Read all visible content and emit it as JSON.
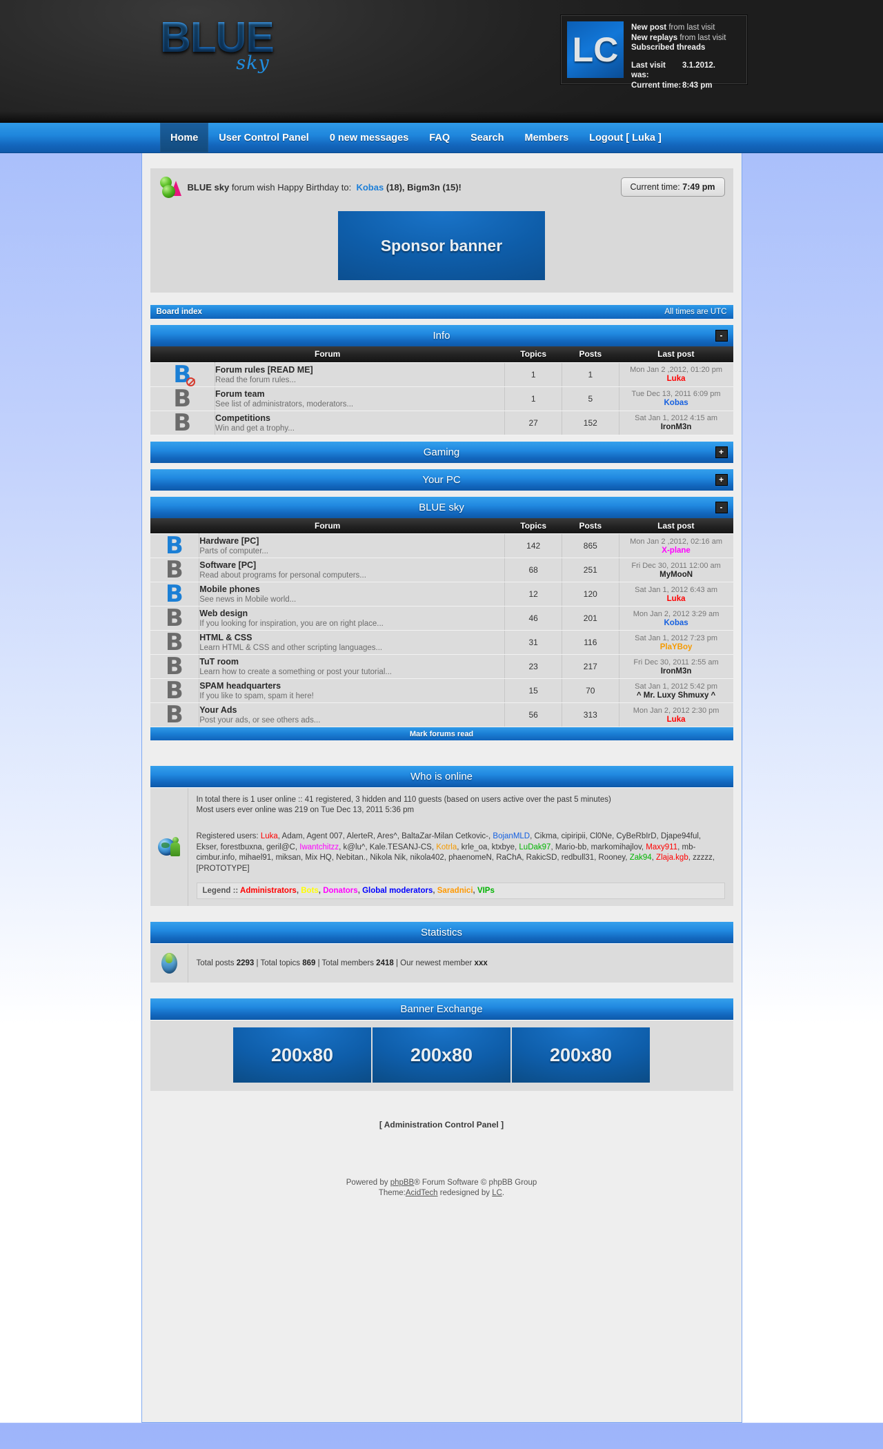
{
  "header": {
    "logo_main": "BLUE",
    "logo_sub": "sky",
    "infobox": {
      "avatar_text": "LC",
      "line1_strong": "New post",
      "line1_rest": " from last visit",
      "line2_strong": "New replays",
      "line2_rest": " from last visit",
      "line3": "Subscribed threads",
      "last_visit_label": "Last visit was:",
      "last_visit_value": "3.1.2012.",
      "current_time_label": "Current time:",
      "current_time_value": "8:43 pm"
    }
  },
  "nav": {
    "items": [
      {
        "label": "Home",
        "active": true
      },
      {
        "label": "User Control Panel",
        "active": false
      },
      {
        "label": "0 new messages",
        "active": false
      },
      {
        "label": "FAQ",
        "active": false
      },
      {
        "label": "Search",
        "active": false
      },
      {
        "label": "Members",
        "active": false
      },
      {
        "label": "Logout [ Luka ]",
        "active": false
      }
    ]
  },
  "announce": {
    "prefix_bold": "BLUE sky",
    "prefix_rest": " forum wish Happy Birthday to:",
    "birthday_link": "Kobas",
    "birthday_rest": " (18), Bigm3n (15)!",
    "current_time_button_label": "Current time:",
    "current_time_button_value": "7:49 pm",
    "sponsor_banner": "Sponsor banner"
  },
  "boardbar": {
    "left": "Board index",
    "right": "All times are UTC"
  },
  "table_headers": {
    "forum": "Forum",
    "topics": "Topics",
    "posts": "Posts",
    "last_post": "Last post"
  },
  "categories": [
    {
      "title": "Info",
      "collapsed": false,
      "toggle": "-",
      "forums": [
        {
          "icon": "forum-icon-locked-new",
          "icon_state": "blue",
          "locked": true,
          "title": "Forum rules [READ ME]",
          "desc": "Read the forum rules...",
          "topics": "1",
          "posts": "1",
          "last_date": "Mon Jan 2 ,2012, 01:20 pm",
          "last_user": "Luka",
          "last_user_color": "#ff0000"
        },
        {
          "icon": "forum-icon-read",
          "icon_state": "gray",
          "locked": false,
          "title": "Forum team",
          "desc": "See list of administrators, moderators...",
          "topics": "1",
          "posts": "5",
          "last_date": "Tue Dec 13, 2011 6:09 pm",
          "last_user": "Kobas",
          "last_user_color": "#1560e0"
        },
        {
          "icon": "forum-icon-read",
          "icon_state": "gray",
          "locked": false,
          "title": "Competitions",
          "desc": "Win and get a trophy...",
          "topics": "27",
          "posts": "152",
          "last_date": "Sat Jan 1, 2012 4:15 am",
          "last_user": "IronM3n",
          "last_user_color": "#222222"
        }
      ]
    },
    {
      "title": "Gaming",
      "collapsed": true,
      "toggle": "+",
      "forums": []
    },
    {
      "title": "Your PC",
      "collapsed": true,
      "toggle": "+",
      "forums": []
    },
    {
      "title": "BLUE sky",
      "collapsed": false,
      "toggle": "-",
      "forums": [
        {
          "icon": "forum-icon-new",
          "icon_state": "blue",
          "locked": false,
          "title": "Hardware [PC]",
          "desc": "Parts of computer...",
          "topics": "142",
          "posts": "865",
          "last_date": "Mon Jan 2 ,2012, 02:16 am",
          "last_user": "X-plane",
          "last_user_color": "#ff00ff"
        },
        {
          "icon": "forum-icon-read",
          "icon_state": "gray",
          "locked": false,
          "title": "Software [PC]",
          "desc": "Read about programs for personal computers...",
          "topics": "68",
          "posts": "251",
          "last_date": "Fri Dec 30, 2011 12:00 am",
          "last_user": "MyMooN",
          "last_user_color": "#222222"
        },
        {
          "icon": "forum-icon-new",
          "icon_state": "blue",
          "locked": false,
          "title": "Mobile phones",
          "desc": "See news in Mobile world...",
          "topics": "12",
          "posts": "120",
          "last_date": "Sat Jan 1, 2012 6:43 am",
          "last_user": "Luka",
          "last_user_color": "#ff0000"
        },
        {
          "icon": "forum-icon-read",
          "icon_state": "gray",
          "locked": false,
          "title": "Web design",
          "desc": "If you looking for inspiration, you are on right place...",
          "topics": "46",
          "posts": "201",
          "last_date": "Mon Jan 2, 2012 3:29 am",
          "last_user": "Kobas",
          "last_user_color": "#1560e0"
        },
        {
          "icon": "forum-icon-read",
          "icon_state": "gray",
          "locked": false,
          "title": "HTML & CSS",
          "desc": "Learn HTML & CSS and other scripting languages...",
          "topics": "31",
          "posts": "116",
          "last_date": "Sat Jan 1, 2012 7:23 pm",
          "last_user": "PlaYBoy",
          "last_user_color": "#f59a00"
        },
        {
          "icon": "forum-icon-read",
          "icon_state": "gray",
          "locked": false,
          "title": "TuT room",
          "desc": "Learn how to create a something or post your tutorial...",
          "topics": "23",
          "posts": "217",
          "last_date": "Fri Dec 30, 2011 2:55 am",
          "last_user": "IronM3n",
          "last_user_color": "#222222"
        },
        {
          "icon": "forum-icon-read",
          "icon_state": "gray",
          "locked": false,
          "title": "SPAM headquarters",
          "desc": "If you like to spam, spam it here!",
          "topics": "15",
          "posts": "70",
          "last_date": "Sat Jan 1, 2012 5:42 pm",
          "last_user": "^ Mr. Luxy Shmuxy ^",
          "last_user_color": "#222222"
        },
        {
          "icon": "forum-icon-read",
          "icon_state": "gray",
          "locked": false,
          "title": "Your Ads",
          "desc": "Post your ads, or see others ads...",
          "topics": "56",
          "posts": "313",
          "last_date": "Mon Jan 2, 2012 2:30 pm",
          "last_user": "Luka",
          "last_user_color": "#ff0000"
        }
      ]
    }
  ],
  "mark_forums_read": "Mark forums read",
  "who_is_online": {
    "title": "Who is online",
    "line1": "In total there is 1 user online :: 41 registered, 3 hidden and 110 guests (based on users active over the past 5 minutes)",
    "line2": "Most users ever online was 219 on Tue Dec 13, 2011 5:36 pm",
    "users_prefix": "Registered users:",
    "users": [
      {
        "name": "Luka",
        "color": "#ff0000"
      },
      {
        "name": "Adam",
        "color": "#3a3a3a"
      },
      {
        "name": "Agent 007",
        "color": "#3a3a3a"
      },
      {
        "name": "AlerteR",
        "color": "#3a3a3a"
      },
      {
        "name": "Ares^",
        "color": "#3a3a3a"
      },
      {
        "name": "BaltaZar-Milan Cetkovic-",
        "color": "#3a3a3a"
      },
      {
        "name": "BojanMLD",
        "color": "#1560e0"
      },
      {
        "name": "Cikma",
        "color": "#3a3a3a"
      },
      {
        "name": "cipiripii",
        "color": "#3a3a3a"
      },
      {
        "name": "Cl0Ne",
        "color": "#3a3a3a"
      },
      {
        "name": "CyBeRbIrD",
        "color": "#3a3a3a"
      },
      {
        "name": "Djape94ful",
        "color": "#3a3a3a"
      },
      {
        "name": "Ekser",
        "color": "#3a3a3a"
      },
      {
        "name": "forestbuxna",
        "color": "#3a3a3a"
      },
      {
        "name": "geril@C",
        "color": "#3a3a3a"
      },
      {
        "name": "Iwantchitzz",
        "color": "#ff00ff"
      },
      {
        "name": "k@lu^",
        "color": "#3a3a3a"
      },
      {
        "name": "Kale.TESANJ-CS",
        "color": "#3a3a3a"
      },
      {
        "name": "Kotrla",
        "color": "#f59a00"
      },
      {
        "name": "krle_oa",
        "color": "#3a3a3a"
      },
      {
        "name": "ktxbye",
        "color": "#3a3a3a"
      },
      {
        "name": "LuDak97",
        "color": "#00b400"
      },
      {
        "name": "Mario-bb",
        "color": "#3a3a3a"
      },
      {
        "name": "markomihajlov",
        "color": "#3a3a3a"
      },
      {
        "name": "Maxy911",
        "color": "#ff0000"
      },
      {
        "name": "mb-cimbur.info",
        "color": "#3a3a3a"
      },
      {
        "name": "mihael91",
        "color": "#3a3a3a"
      },
      {
        "name": "miksan",
        "color": "#3a3a3a"
      },
      {
        "name": "Mix HQ",
        "color": "#3a3a3a"
      },
      {
        "name": "Nebitan.",
        "color": "#3a3a3a"
      },
      {
        "name": "Nikola Nik",
        "color": "#3a3a3a"
      },
      {
        "name": "nikola402",
        "color": "#3a3a3a"
      },
      {
        "name": "phaenomeN",
        "color": "#3a3a3a"
      },
      {
        "name": "RaChA",
        "color": "#3a3a3a"
      },
      {
        "name": "RakicSD",
        "color": "#3a3a3a"
      },
      {
        "name": "redbull31",
        "color": "#3a3a3a"
      },
      {
        "name": "Rooney",
        "color": "#3a3a3a"
      },
      {
        "name": "Zak94",
        "color": "#00b400"
      },
      {
        "name": "Zlaja.kgb",
        "color": "#ff0000"
      },
      {
        "name": "zzzzz",
        "color": "#3a3a3a"
      },
      {
        "name": "[PROTOTYPE]",
        "color": "#3a3a3a"
      }
    ],
    "legend_prefix": "Legend ::",
    "legend": [
      {
        "label": "Administrators",
        "color": "#ff0000"
      },
      {
        "label": "Bots",
        "color": "#ffff00"
      },
      {
        "label": "Donators",
        "color": "#ff00ff"
      },
      {
        "label": "Global moderators",
        "color": "#0000ff"
      },
      {
        "label": "Saradnici",
        "color": "#ff9900"
      },
      {
        "label": "VIPs",
        "color": "#00b400"
      }
    ]
  },
  "statistics": {
    "title": "Statistics",
    "total_posts_label": "Total posts",
    "total_posts": "2293",
    "total_topics_label": "Total topics",
    "total_topics": "869",
    "total_members_label": "Total members",
    "total_members": "2418",
    "newest_member_label": "Our newest member",
    "newest_member": "xxx"
  },
  "banner_exchange": {
    "title": "Banner Exchange",
    "banners": [
      "200x80",
      "200x80",
      "200x80"
    ]
  },
  "acp_link": "[ Administration Control Panel ]",
  "footer": {
    "line1_pre": "Powered by ",
    "line1_link": "phpBB",
    "line1_post": "® Forum Software © phpBB Group",
    "line2_pre": "Theme:",
    "line2_link1": "AcidTech",
    "line2_mid": " redesigned by ",
    "line2_link2": "LC",
    "line2_post": "."
  }
}
